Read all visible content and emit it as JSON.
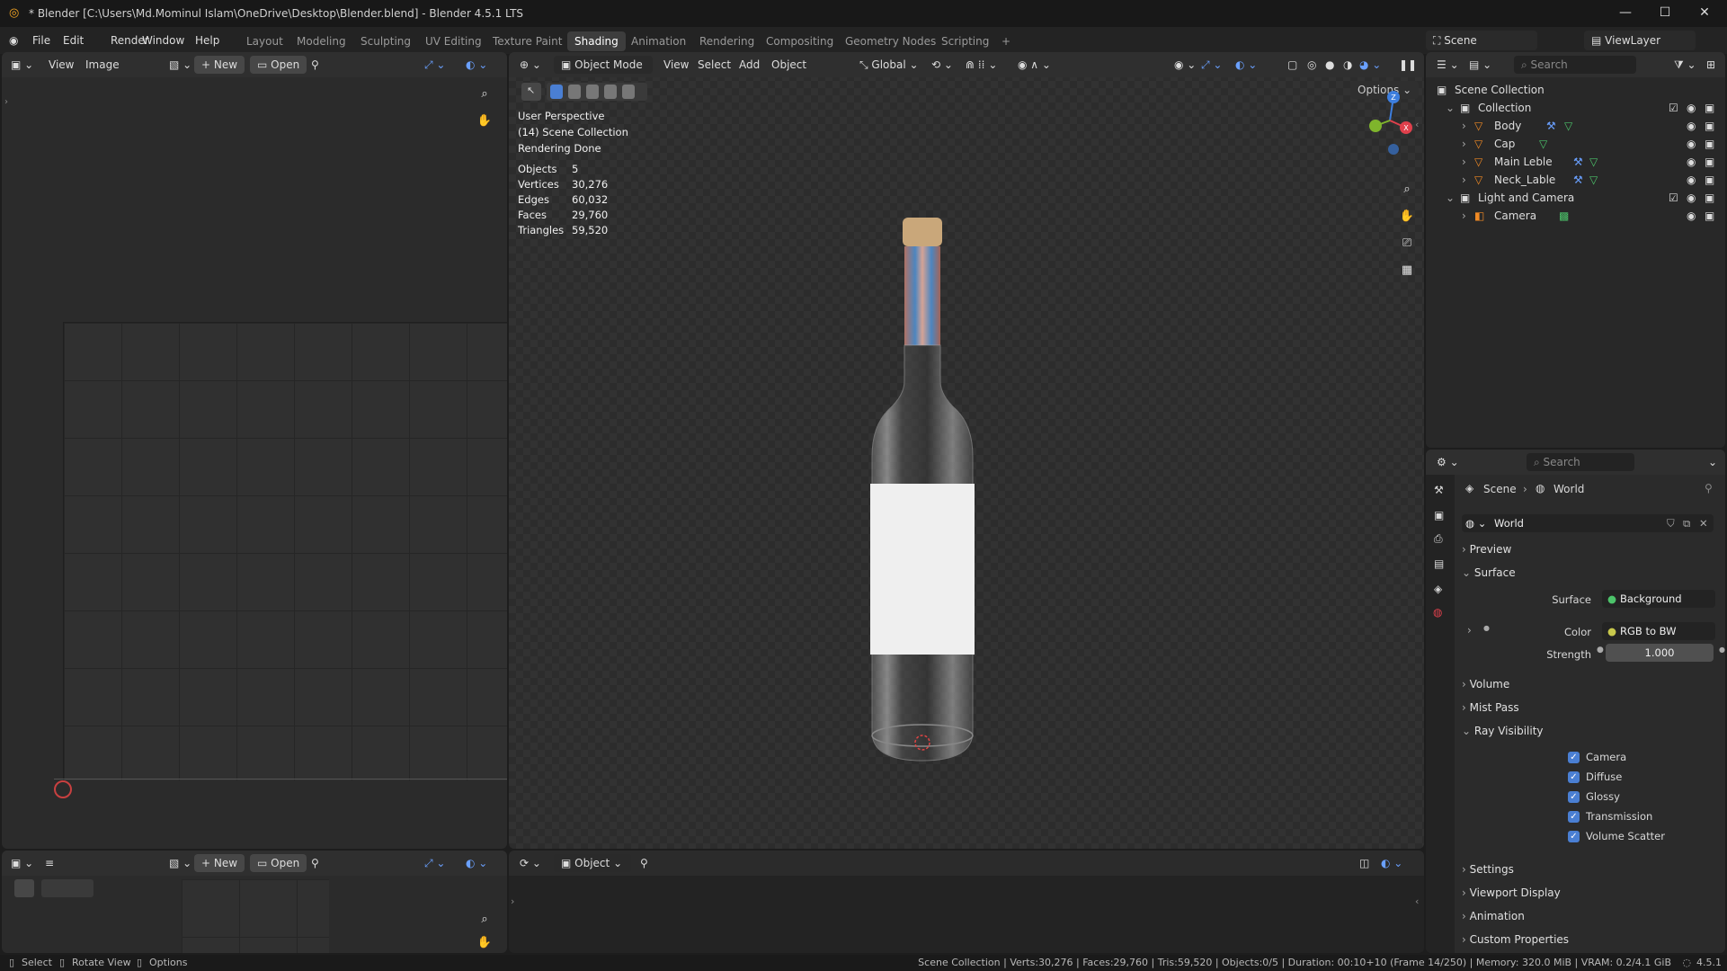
{
  "titlebar": {
    "title": "* Blender [C:\\Users\\Md.Mominul Islam\\OneDrive\\Desktop\\Blender.blend] - Blender 4.5.1 LTS",
    "minimize": "—",
    "maximize": "☐",
    "close": "✕"
  },
  "menu": [
    "File",
    "Edit",
    "Render",
    "Window",
    "Help"
  ],
  "workspaces": [
    "Layout",
    "Modeling",
    "Sculpting",
    "UV Editing",
    "Texture Paint",
    "Shading",
    "Animation",
    "Rendering",
    "Compositing",
    "Geometry Nodes",
    "Scripting",
    "+"
  ],
  "active_workspace": "Shading",
  "scene_selector": {
    "scene": "Scene",
    "view_layer": "ViewLayer"
  },
  "image_editor": {
    "view": "View",
    "image": "Image",
    "new": "New",
    "open": "Open"
  },
  "viewport": {
    "mode": "Object Mode",
    "menus": [
      "View",
      "Select",
      "Add",
      "Object"
    ],
    "transform": "Global",
    "options": "Options",
    "overlay_lines": [
      "User Perspective",
      "(14) Scene Collection",
      "Rendering Done"
    ],
    "stats": [
      {
        "label": "Objects",
        "value": "5"
      },
      {
        "label": "Vertices",
        "value": "30,276"
      },
      {
        "label": "Edges",
        "value": "60,032"
      },
      {
        "label": "Faces",
        "value": "29,760"
      },
      {
        "label": "Triangles",
        "value": "59,520"
      }
    ],
    "gizmo": {
      "x": "X",
      "y": "Y",
      "z": "Z"
    }
  },
  "node_editor": {
    "object": "Object",
    "new": "New",
    "open": "Open"
  },
  "outliner": {
    "search_placeholder": "Search",
    "rows": [
      {
        "label": "Scene Collection",
        "depth": 0
      },
      {
        "label": "Collection",
        "depth": 1
      },
      {
        "label": "Body",
        "depth": 2
      },
      {
        "label": "Cap",
        "depth": 2
      },
      {
        "label": "Main Leble",
        "depth": 2
      },
      {
        "label": "Neck_Lable",
        "depth": 2
      },
      {
        "label": "Light and Camera",
        "depth": 1
      },
      {
        "label": "Camera",
        "depth": 2
      }
    ]
  },
  "properties": {
    "search_placeholder": "Search",
    "breadcrumb": [
      "Scene",
      "World"
    ],
    "datablock": "World",
    "panels": {
      "preview": "Preview",
      "surface": "Surface",
      "volume": "Volume",
      "mist": "Mist Pass",
      "ray_visibility": "Ray Visibility",
      "settings": "Settings",
      "viewport_display": "Viewport Display",
      "animation": "Animation",
      "custom": "Custom Properties"
    },
    "surface_label": "Surface",
    "surface_value": "Background",
    "color_label": "Color",
    "color_value": "RGB to BW",
    "strength_label": "Strength",
    "strength_value": "1.000",
    "ray_checks": [
      "Camera",
      "Diffuse",
      "Glossy",
      "Transmission",
      "Volume Scatter"
    ]
  },
  "statusbar": {
    "left": [
      "Select",
      "Rotate View",
      "Options"
    ],
    "right": "Scene Collection | Verts:30,276 | Faces:29,760 | Tris:59,520 | Objects:0/5 | Duration: 00:10+10 (Frame 14/250) | Memory: 320.0 MiB | VRAM: 0.2/4.1 GiB",
    "version": "4.5.1"
  },
  "colors": {
    "accent": "#4a7fd3",
    "x_axis": "#e0404c",
    "y_axis": "#7fb52c",
    "z_axis": "#3d7ede"
  }
}
